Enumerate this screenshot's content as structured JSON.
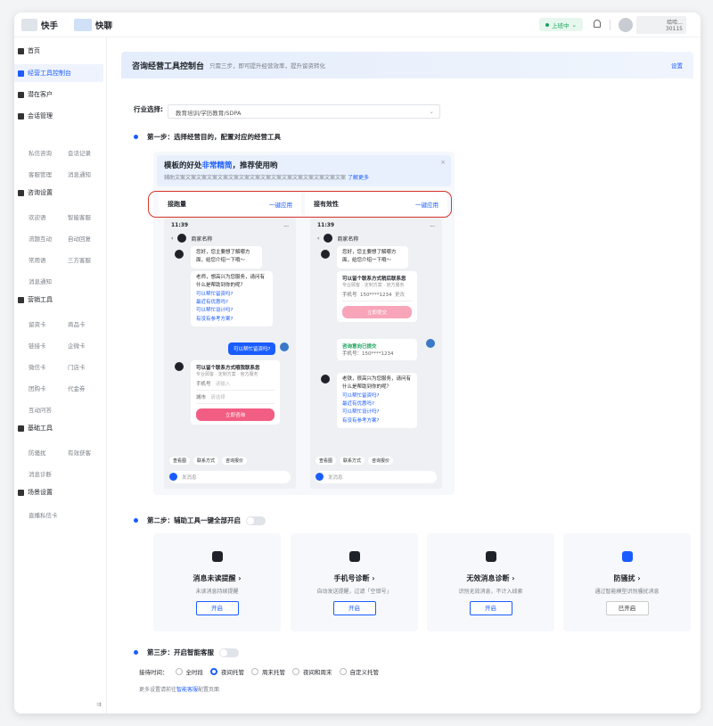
{
  "topbar": {
    "app_kuaishou": "快手",
    "app_kuailiao": "快聊",
    "status": "上班中",
    "user_name": "给哈...",
    "user_sub": "30115"
  },
  "sidebar": {
    "home": "首页",
    "console": "经营工具控制台",
    "potential": "潜在客户",
    "session": "会话管理",
    "session_subs": [
      "私信咨询",
      "会话记录",
      "客服管理",
      "消息通知"
    ],
    "consult": "咨询设置",
    "consult_subs": [
      "欢迎语",
      "智能客服",
      "流题互动",
      "自动回复",
      "常用语",
      "三方客服",
      "消息通知"
    ],
    "marketing": "营销工具",
    "marketing_subs": [
      "留资卡",
      "商品卡",
      "链接卡",
      "企微卡",
      "微信卡",
      "门店卡",
      "团购卡",
      "代金券",
      "互动问答"
    ],
    "basic": "基础工具",
    "basic_subs": [
      "防骚扰",
      "有效获客",
      "消息诊断"
    ],
    "scene": "场景设置",
    "scene_subs": [
      "直播私信卡"
    ]
  },
  "header": {
    "title": "咨询经营工具控制台",
    "subtitle": "只需三步，即可提升经营效率，提升留资转化",
    "settings": "设置"
  },
  "industry": {
    "label": "行业选择:",
    "value": "教育培训/学历教育/SDPA"
  },
  "step1": {
    "title": "第一步：选择经营目的，配置对应的经营工具",
    "banner_prefix": "模板的好处",
    "banner_em": "非常精简",
    "banner_suffix": "，推荐使用哟",
    "banner_sub": "辅助文案文案文案文案文案文案文案文案文案文案文案文案文案文案文案文案",
    "more": "了解更多",
    "close": "×",
    "col1": "接跑量",
    "col2": "接有效性",
    "apply": "一键应用"
  },
  "phone1": {
    "time": "11:39",
    "bat": "...",
    "merchant": "商家名称",
    "msg1": "您好，您主要想了解哪方面，给您介绍一下哦～",
    "msg2": "老师，想高兴为您服务，请问有什么是帮助到你的呢？",
    "links": [
      "可以帮忙留资吗?",
      "最近有优惠吗?",
      "可以帮忙设计吗?",
      "有没有参考方案?"
    ],
    "mine": "可以帮忙留资吗?",
    "form_title": "可以留个联系方式哦我联系您",
    "opts": "专业顾客 · 定制方案 · 官方服务",
    "phone_label": "手机号",
    "phone_ph": "请输入",
    "city_label": "城市",
    "city_ph": "请选择",
    "submit": "立即咨询",
    "chips": [
      "查看图",
      "联系方式",
      "咨询报价"
    ],
    "input_ph": "发消息"
  },
  "phone2": {
    "time": "11:39",
    "bat": "...",
    "merchant": "商家名称",
    "msg1": "您好，您主要想了解哪方面，给您介绍一下哦～",
    "form_title": "可以留个联系方式稍后联系您",
    "opts": "专业顾客 · 定制方案 · 官方服务",
    "phone_label": "手机号",
    "phone_val": "150****1234",
    "phone_edit": "更改",
    "submit": "立即提交",
    "done": "咨询意向已提交",
    "done_phone": "手机号：150****1234",
    "msg2": "老铁，很高兴为您服务，请问有什么是帮助到你的呢？",
    "links": [
      "可以帮忙留资吗?",
      "最近有优惠吗?",
      "可以帮忙设计吗?",
      "有没有参考方案?"
    ],
    "chips": [
      "查看图",
      "联系方式",
      "咨询报价"
    ],
    "input_ph": "发消息"
  },
  "step2": {
    "title": "第二步：辅助工具一键全部开启",
    "cards": [
      {
        "title": "消息未读提醒 ›",
        "sub": "未读消息持续提醒",
        "btn": "开启"
      },
      {
        "title": "手机号诊断 ›",
        "sub": "自动发送提醒，过滤「空错号」",
        "btn": "开启"
      },
      {
        "title": "无效消息诊断 ›",
        "sub": "识别无效消息，不计入线索",
        "btn": "开启"
      },
      {
        "title": "防骚扰 ›",
        "sub": "通过智能模型识别骚扰消息",
        "btn": "已开启"
      }
    ]
  },
  "step3": {
    "title": "第三步：开启智能客服",
    "time_label": "接待时间：",
    "options": [
      "全时段",
      "夜间托管",
      "周末托管",
      "夜间和周末",
      "自定义托管"
    ],
    "selected": "夜间托管",
    "note_a": "更多设置请前往",
    "note_link": "智能客服",
    "note_b": "配置页面"
  },
  "collapse_icon": "⇉"
}
